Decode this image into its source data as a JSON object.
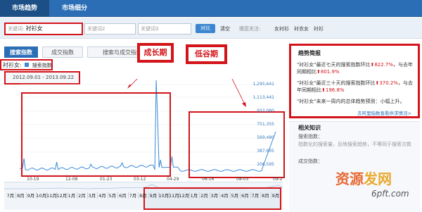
{
  "nav": {
    "tabs": [
      {
        "label": "市场趋势"
      },
      {
        "label": "市场细分"
      }
    ]
  },
  "search": {
    "field1_label": "关键词:",
    "field1_value": "衬衫女",
    "field2_placeholder": "关键词2",
    "field3_placeholder": "关键词3",
    "compare_label": "对比",
    "clear_label": "清空",
    "related_label": "猜您关注:",
    "related": [
      "女衬衫",
      "衬衣女",
      "衬衫"
    ]
  },
  "subtabs": [
    "搜索指数",
    "成交指数",
    "搜索与成交指数"
  ],
  "annotations": {
    "growth": "成长期",
    "trough": "低谷期"
  },
  "chart": {
    "legend_keyword": "衬衫女:",
    "legend_series": "搜索指数",
    "date_range": "2012.09.01 - 2013.09.22",
    "yticks": [
      "1,295,641",
      "1,113,441",
      "932,080",
      "751,355",
      "569,480",
      "387,605",
      "206,595"
    ],
    "xticks": [
      "10-19",
      "12-08",
      "01-23",
      "03-12",
      "04-29",
      "06-16",
      "08-03",
      "09-2"
    ],
    "months": [
      "7月",
      "8月",
      "9月",
      "10月",
      "11月",
      "12月",
      "1月",
      "2月",
      "3月",
      "4月",
      "5月",
      "6月",
      "7月",
      "8月",
      "9月",
      "10月",
      "11月",
      "12月",
      "1月",
      "2月",
      "3月",
      "4月",
      "5月",
      "6月",
      "7月",
      "8月",
      "9月"
    ]
  },
  "colors": {
    "nav": "#2c6eb5",
    "accent": "#d3141a",
    "line": "#3a8ad6"
  },
  "sidebar": {
    "trend_title": "趋势简报",
    "l1": "\"衬衫女\"最近七天的搜索指数环比",
    "l1_v": "822.7%",
    "l1_b": "，与去年同期相比",
    "l1_v2": "801.9%",
    "l2": "\"衬衫女\"最近三十天的搜索指数环比",
    "l2_v": "370.2%",
    "l2_b": "，与去年同期相比",
    "l2_v2": "196.8%",
    "l3": "\"衬衫女\"未来一周内的总体趋势预测：小幅上升。",
    "more_link": "去阿里指数查看供求情况>",
    "know_title": "相关知识",
    "know_sub": "搜索指数：",
    "know_text": "指数化的搜索量，反映搜索趋势，不等同于搜索次数",
    "know_sub2": "成交指数："
  },
  "watermark": {
    "t1": "资源",
    "t2": "发网",
    "t3": "6pft.com"
  }
}
